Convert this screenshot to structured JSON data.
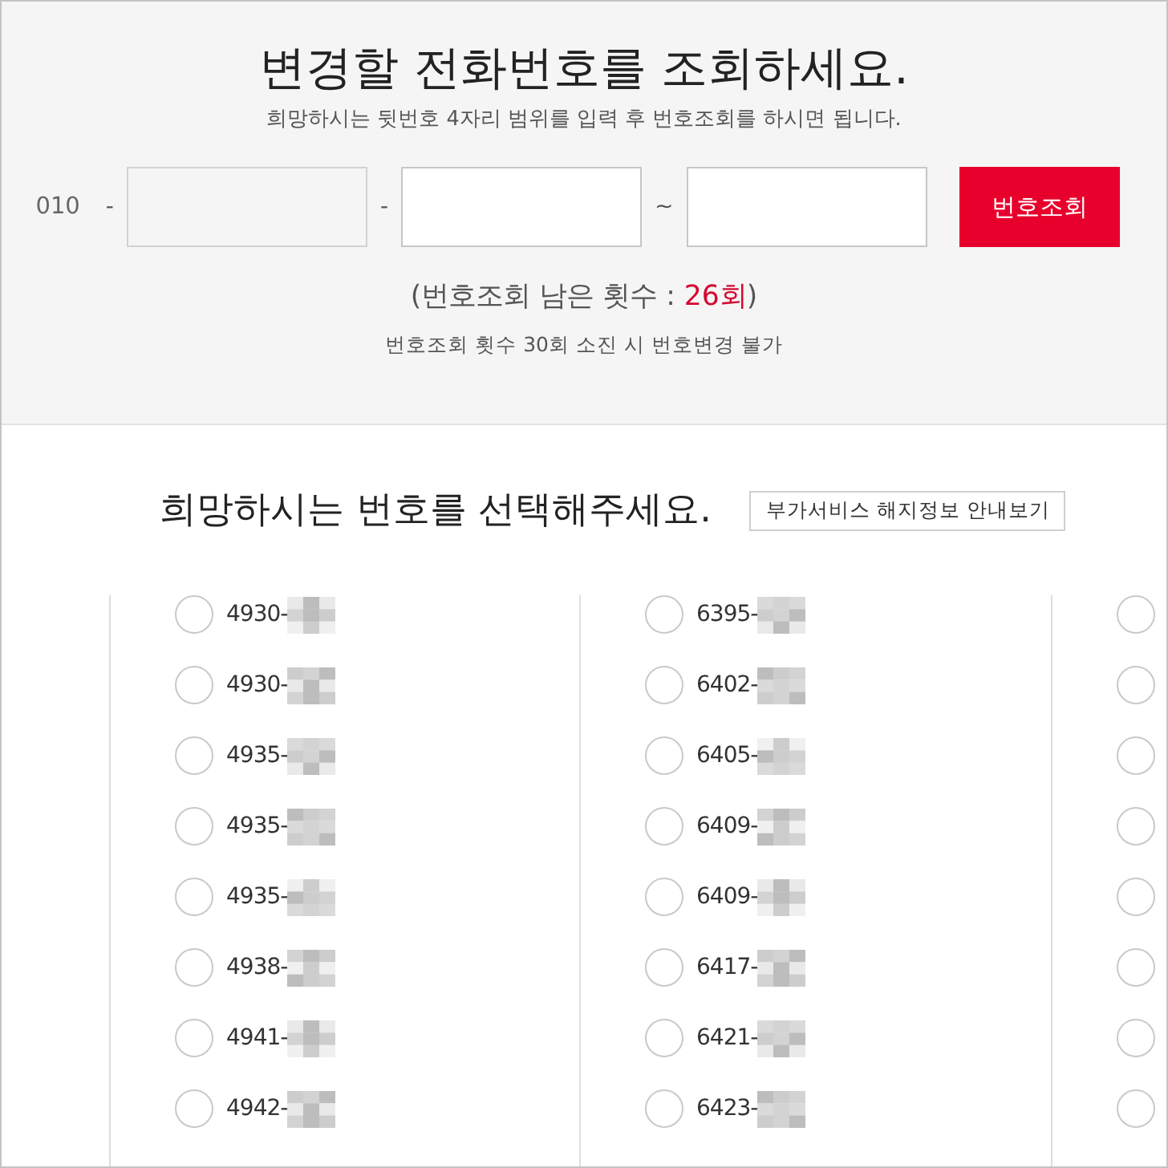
{
  "search_panel": {
    "title": "변경할 전화번호를 조회하세요.",
    "subtitle": "희망하시는 뒷번호 4자리 범위를 입력 후 번호조회를 하시면 됩니다.",
    "prefix": "010",
    "inputs": [
      {
        "separator": "-",
        "kind": "readonly"
      },
      {
        "separator": "-",
        "kind": "input"
      },
      {
        "separator": "~",
        "kind": "input"
      }
    ],
    "button": "번호조회",
    "remaining": {
      "text": "(번호조회 남은 횟수 : ",
      "count": "26회",
      "close": ")"
    },
    "note": "번호조회 횟수 30회 소진 시 번호변경 불가"
  },
  "number_select": {
    "title": "희망하시는 번호를 선택해주세요.",
    "info_button": "부가서비스 해지정보 안내보기",
    "columns": [
      {
        "items": [
          {
            "number": "4930-",
            "masked": true,
            "selected": false
          },
          {
            "number": "4930-",
            "masked": true,
            "selected": false
          },
          {
            "number": "4935-",
            "masked": true,
            "selected": false
          },
          {
            "number": "4935-",
            "masked": true,
            "selected": false
          },
          {
            "number": "4935-",
            "masked": true,
            "selected": false
          },
          {
            "number": "4938-",
            "masked": true,
            "selected": false
          },
          {
            "number": "4941-",
            "masked": true,
            "selected": false
          },
          {
            "number": "4942-",
            "masked": true,
            "selected": false
          }
        ]
      },
      {
        "items": [
          {
            "number": "6395-",
            "masked": true,
            "selected": false
          },
          {
            "number": "6402-",
            "masked": true,
            "selected": false
          },
          {
            "number": "6405-",
            "masked": true,
            "selected": false
          },
          {
            "number": "6409-",
            "masked": true,
            "selected": false
          },
          {
            "number": "6409-",
            "masked": true,
            "selected": false
          },
          {
            "number": "6417-",
            "masked": true,
            "selected": false
          },
          {
            "number": "6421-",
            "masked": true,
            "selected": false
          },
          {
            "number": "6423-",
            "masked": true,
            "selected": false
          }
        ]
      },
      {
        "items": [
          {
            "selected": false
          },
          {
            "selected": false
          },
          {
            "selected": false
          },
          {
            "selected": false
          },
          {
            "selected": false
          },
          {
            "selected": false
          },
          {
            "selected": false
          },
          {
            "selected": false
          }
        ]
      }
    ]
  }
}
